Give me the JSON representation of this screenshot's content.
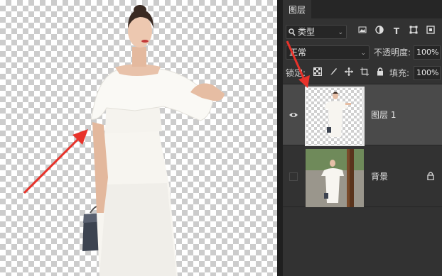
{
  "panel": {
    "tab_label": "图层",
    "filter": {
      "selected": "类型",
      "icon": "search-icon"
    },
    "filter_icons": [
      "image-filter-icon",
      "adjustment-filter-icon",
      "type-filter-icon",
      "shape-filter-icon",
      "smart-object-filter-icon"
    ],
    "blend_mode": "正常",
    "opacity_label": "不透明度:",
    "opacity_value": "100%",
    "lock_label": "锁定:",
    "lock_icons": [
      "lock-transparent-pixels-icon",
      "lock-image-pixels-icon",
      "lock-position-icon",
      "artboard-lock-icon",
      "lock-all-icon"
    ],
    "fill_label": "填充:",
    "fill_value": "100%"
  },
  "layers": [
    {
      "name": "图层 1",
      "visible": true,
      "selected": true,
      "locked": false,
      "thumbnail": "model-cutout-on-transparent"
    },
    {
      "name": "背景",
      "visible": false,
      "selected": false,
      "locked": true,
      "thumbnail": "model-street-photo"
    }
  ],
  "colors": {
    "panel_bg": "#323232",
    "selected_layer_bg": "#4a4a4a",
    "arrow_red": "#e8322a",
    "dress_white": "#f7f5f0"
  }
}
